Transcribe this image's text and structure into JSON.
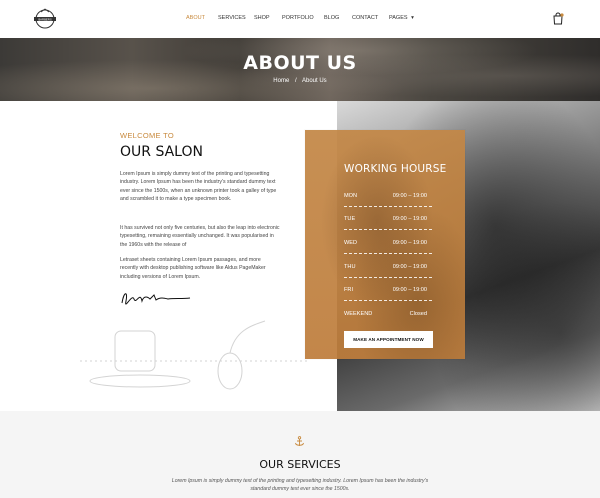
{
  "nav": {
    "items": [
      {
        "label": "ABOUT",
        "active": true
      },
      {
        "label": "SERVICES"
      },
      {
        "label": "SHOP"
      },
      {
        "label": "PORTFOLIO"
      },
      {
        "label": "BLOG"
      },
      {
        "label": "CONTACT"
      },
      {
        "label": "PAGES"
      }
    ],
    "logo_text": "BARBERS",
    "cart_icon": "shopping-bag-icon",
    "accent_color": "#c88a3e"
  },
  "hero": {
    "title": "ABOUT US",
    "breadcrumb": {
      "home": "Home",
      "separator": "/",
      "current": "About Us"
    }
  },
  "about": {
    "kicker": "WELCOME TO",
    "title": "OUR SALON",
    "paragraphs": [
      "Lorem Ipsum is simply dummy text of the printing and typesetting industry. Lorem Ipsum has been the industry's standard dummy text ever since the 1500s, when an unknown printer took a galley of type and scrambled it to make a type specimen book.",
      "It has survived not only five centuries, but also the leap into electronic typesetting, remaining essentially unchanged. It was popularised in the 1960s with the release of",
      "Letraset sheets containing Lorem Ipsum passages, and more recently with desktop publishing software like Aldus PageMaker including versions of Lorem Ipsum."
    ]
  },
  "hours": {
    "title": "WORKING HOURSE",
    "rows": [
      {
        "day": "MON",
        "time": "09:00 – 19:00"
      },
      {
        "day": "TUE",
        "time": "09:00 – 19:00"
      },
      {
        "day": "WED",
        "time": "09:00 – 19:00"
      },
      {
        "day": "THU",
        "time": "09:00 – 19:00"
      },
      {
        "day": "FRI",
        "time": "09:00 – 19:00"
      },
      {
        "day": "WEEKEND",
        "time": "Closed"
      }
    ],
    "button_label": "MAKE AN APPOINTMENT NOW"
  },
  "services": {
    "title": "OUR SERVICES",
    "text": "Lorem Ipsum is simply dummy text of the printing and typesetting industry. Lorem Ipsum has been the industry's standard dummy text ever since the 1500s."
  }
}
